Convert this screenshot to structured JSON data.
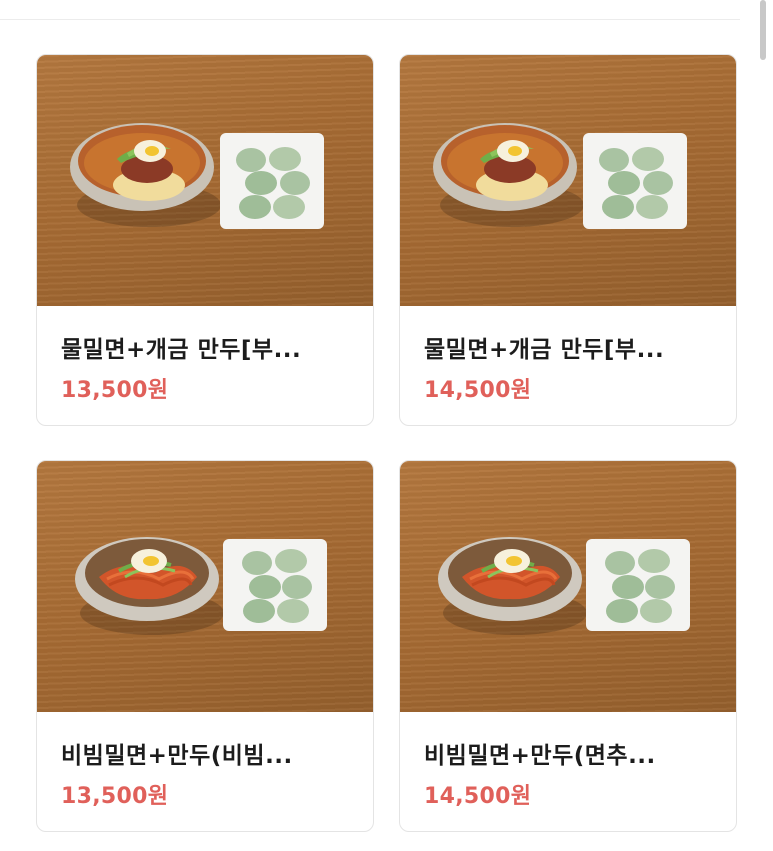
{
  "products": [
    {
      "title": "물밀면+개금 만두[부...",
      "price": "13,500원",
      "image": "mul-milmyeon-dumpling-photo"
    },
    {
      "title": "물밀면+개금 만두[부...",
      "price": "14,500원",
      "image": "mul-milmyeon-dumpling-photo"
    },
    {
      "title": "비빔밀면+만두(비빔...",
      "price": "13,500원",
      "image": "bibim-milmyeon-dumpling-photo"
    },
    {
      "title": "비빔밀면+만두(면추...",
      "price": "14,500원",
      "image": "bibim-milmyeon-dumpling-photo"
    }
  ]
}
